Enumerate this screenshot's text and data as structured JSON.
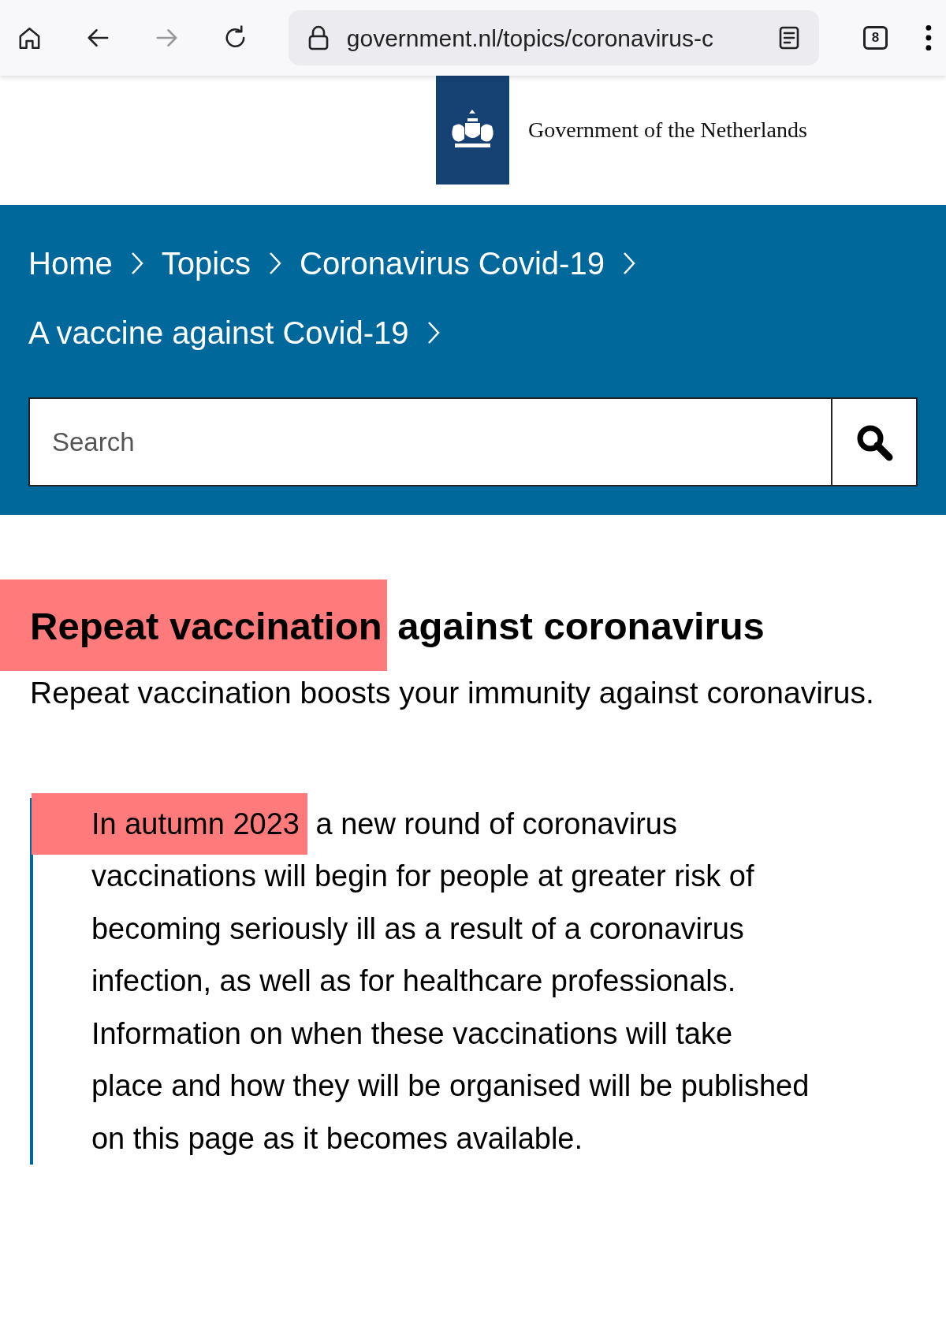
{
  "browser": {
    "url": "government.nl/topics/coronavirus-c",
    "forward_disabled": true,
    "tab_count": "8"
  },
  "header": {
    "logo_text": "Government of the Netherlands"
  },
  "breadcrumbs": [
    "Home",
    "Topics",
    "Coronavirus Covid-19",
    "A vaccine against Covid-19"
  ],
  "search": {
    "placeholder": "Search"
  },
  "heading": [
    {
      "text": "Repeat vaccination",
      "highlighted": true
    },
    {
      "text": " against coronavirus",
      "highlighted": false
    }
  ],
  "intro": "Repeat vaccination boosts your immunity against coronavirus.",
  "quote": [
    {
      "text": "In autumn 2023",
      "highlighted": true
    },
    {
      "text": " a new round of coronavirus vaccinations will begin for people at greater risk of becoming seriously ill as a result of a coronavirus infection, as well as for healthcare professionals. Information on when these vaccinations will take place and how they will be organised will be published on this page as it becomes available.",
      "highlighted": false
    }
  ]
}
